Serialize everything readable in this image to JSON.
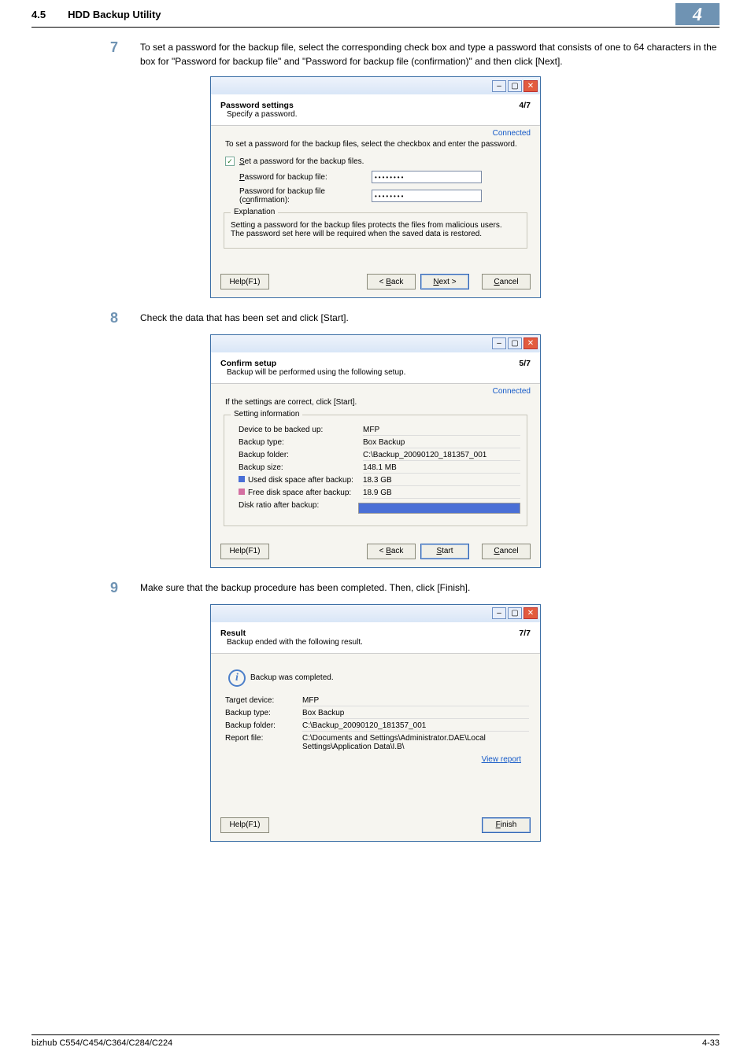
{
  "header": {
    "section_no": "4.5",
    "section_title": "HDD Backup Utility",
    "chapter": "4"
  },
  "steps": {
    "s7": {
      "num": "7",
      "text": "To set a password for the backup file, select the corresponding check box and type a password that consists of one to 64 characters in the box for \"Password for backup file\" and \"Password for backup file (confirmation)\" and then click [Next]."
    },
    "s8": {
      "num": "8",
      "text": "Check the data that has been set and click [Start]."
    },
    "s9": {
      "num": "9",
      "text": "Make sure that the backup procedure has been completed. Then, click [Finish]."
    }
  },
  "dlg1": {
    "head_title": "Password settings",
    "head_sub": "Specify a password.",
    "step_of": "4/7",
    "connected": "Connected",
    "body_text": "To set a password for the backup files, select the checkbox and enter the password.",
    "chk_label_pre": "S",
    "chk_label_post": "et a password for the backup files.",
    "pw_label_pre": "P",
    "pw_label_post": "assword for backup file:",
    "pwc_label": "Password for backup file (c",
    "pwc_label_u": "o",
    "pwc_label_post": "nfirmation):",
    "pw_value": "••••••••",
    "group_title": "Explanation",
    "group_text": "Setting a password for the backup files protects the files from malicious users.\nThe password set here will be required when the saved data is restored.",
    "help": "Help(F1)",
    "back": "< Back",
    "next": "Next >",
    "cancel": "Cancel"
  },
  "dlg2": {
    "head_title": "Confirm setup",
    "head_sub": "Backup will be performed using the following setup.",
    "step_of": "5/7",
    "connected": "Connected",
    "body_text": "If the settings are correct, click [Start].",
    "group_title": "Setting information",
    "r_device_l": "Device to be backed up:",
    "r_device_v": "MFP",
    "r_type_l": "Backup type:",
    "r_type_v": "Box Backup",
    "r_folder_l": "Backup folder:",
    "r_folder_v": "C:\\Backup_20090120_181357_001",
    "r_size_l": "Backup size:",
    "r_size_v": "148.1 MB",
    "r_used_l": "Used disk space after backup:",
    "r_used_v": "18.3 GB",
    "r_free_l": "Free disk space after backup:",
    "r_free_v": "18.9 GB",
    "r_ratio_l": "Disk ratio after backup:",
    "help": "Help(F1)",
    "back": "< Back",
    "start": "Start",
    "cancel": "Cancel"
  },
  "dlg3": {
    "head_title": "Result",
    "head_sub": "Backup ended with the following result.",
    "step_of": "7/7",
    "result_text": "Backup was completed.",
    "r_target_l": "Target device:",
    "r_target_v": "MFP",
    "r_type_l": "Backup type:",
    "r_type_v": "Box Backup",
    "r_folder_l": "Backup folder:",
    "r_folder_v": "C:\\Backup_20090120_181357_001",
    "r_report_l": "Report file:",
    "r_report_v": "C:\\Documents and Settings\\Administrator.DAE\\Local Settings\\Application Data\\I.B\\",
    "view_report": "View report",
    "help": "Help(F1)",
    "finish": "Finish"
  },
  "footer": {
    "left": "bizhub C554/C454/C364/C284/C224",
    "right": "4-33"
  }
}
